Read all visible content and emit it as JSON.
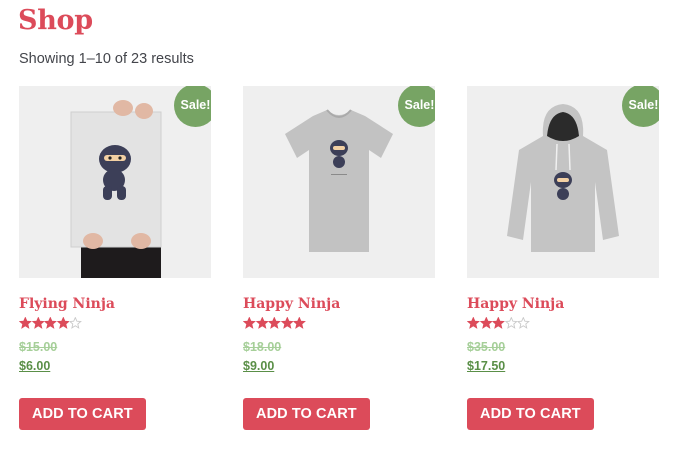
{
  "page": {
    "title": "Shop",
    "result_count": "Showing 1–10 of 23 results"
  },
  "colors": {
    "brand": "#dc4b5a",
    "sale_badge": "#77a464",
    "price": "#5a8f47",
    "old_price": "#a6cf99",
    "star": "#dc4b5a"
  },
  "products": [
    {
      "name": "Flying Ninja",
      "image": "ninja-poster-image",
      "badge": "Sale!",
      "rating": 4,
      "rating_max": 5,
      "old_price": "$15.00",
      "price": "$6.00",
      "button": "ADD TO CART"
    },
    {
      "name": "Happy Ninja",
      "image": "ninja-tshirt-image",
      "badge": "Sale!",
      "rating": 5,
      "rating_max": 5,
      "old_price": "$18.00",
      "price": "$9.00",
      "button": "ADD TO CART"
    },
    {
      "name": "Happy Ninja",
      "image": "ninja-hoodie-image",
      "badge": "Sale!",
      "rating": 3,
      "rating_max": 5,
      "old_price": "$35.00",
      "price": "$17.50",
      "button": "ADD TO CART"
    }
  ]
}
